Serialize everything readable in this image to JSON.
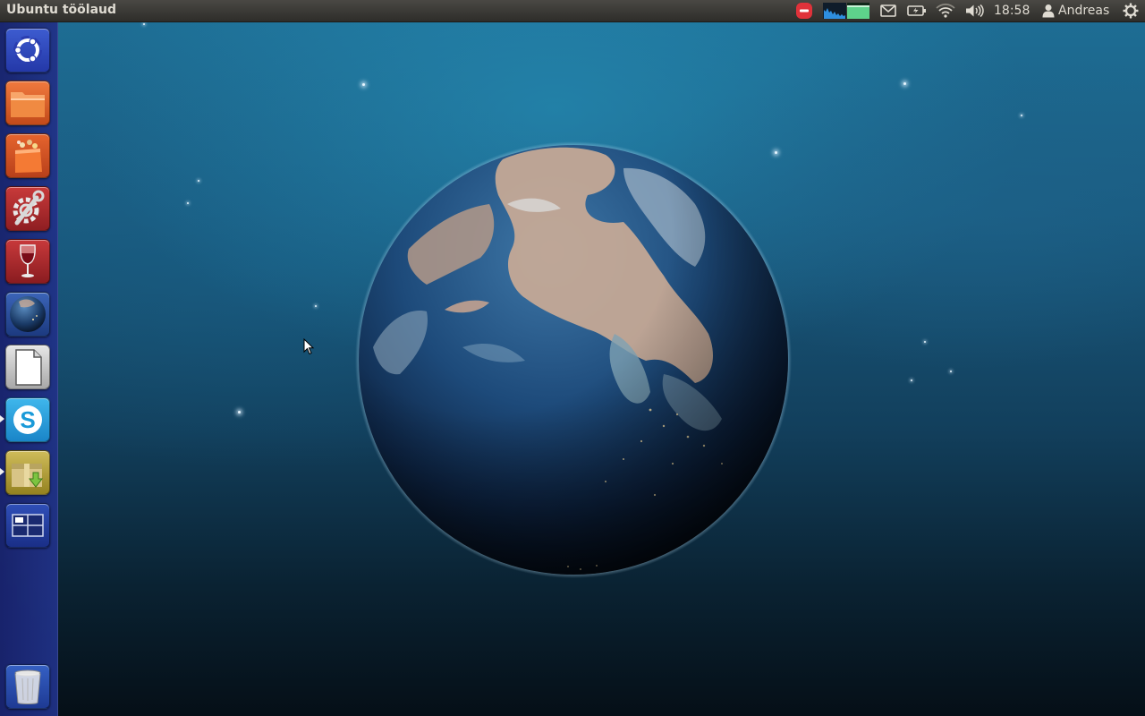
{
  "top_panel": {
    "window_title": "Ubuntu töölaud",
    "clock": "18:58",
    "user_name": "Andreas",
    "indicators": [
      "network-blocked-icon",
      "system-monitor-icon",
      "mail-icon",
      "battery-icon",
      "wifi-icon",
      "volume-icon",
      "user-icon",
      "session-gear-icon"
    ]
  },
  "launcher": {
    "items": [
      {
        "name": "ubuntu-dash",
        "icon": "ubuntu-logo-icon",
        "running": false
      },
      {
        "name": "home-folder",
        "icon": "folder-icon",
        "running": false
      },
      {
        "name": "software-center",
        "icon": "shopping-bag-icon",
        "running": false
      },
      {
        "name": "system-settings",
        "icon": "wrench-gear-icon",
        "running": false
      },
      {
        "name": "wine",
        "icon": "wine-glass-icon",
        "running": false
      },
      {
        "name": "earth-app",
        "icon": "globe-icon",
        "running": false
      },
      {
        "name": "libreoffice",
        "icon": "document-icon",
        "running": false
      },
      {
        "name": "skype",
        "icon": "skype-icon",
        "running": true
      },
      {
        "name": "archive-manager",
        "icon": "package-download-icon",
        "running": true
      },
      {
        "name": "workspace-switcher",
        "icon": "workspaces-icon",
        "running": false
      }
    ],
    "trash": {
      "name": "trash",
      "icon": "trash-icon"
    }
  },
  "colors": {
    "panel": "#3a3935",
    "launcher": "#1f2f85",
    "sky_top": "#1e6f96",
    "sky_bottom": "#050f17"
  }
}
